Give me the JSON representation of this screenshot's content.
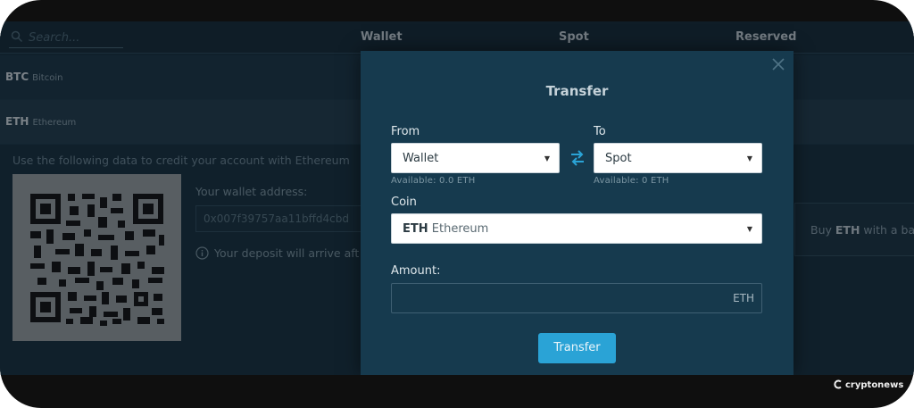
{
  "header": {
    "search_placeholder": "Search...",
    "columns": [
      "Wallet",
      "Spot",
      "Reserved"
    ]
  },
  "assets": [
    {
      "symbol": "BTC",
      "name": "Bitcoin"
    },
    {
      "symbol": "ETH",
      "name": "Ethereum"
    }
  ],
  "deposit": {
    "instruction": "Use the following data to credit your account with Ethereum",
    "wallet_label": "Your wallet address:",
    "wallet_address": "0x007f39757aa11bffd4cbd",
    "notice": "Your deposit will arrive aft",
    "buy_prefix": "Buy",
    "buy_asset": "ETH",
    "buy_suffix": "with a ba"
  },
  "modal": {
    "title": "Transfer",
    "from_label": "From",
    "from_value": "Wallet",
    "from_available": "Available: 0.0 ETH",
    "to_label": "To",
    "to_value": "Spot",
    "to_available": "Available: 0 ETH",
    "coin_label": "Coin",
    "coin_symbol": "ETH",
    "coin_name": "Ethereum",
    "amount_label": "Amount:",
    "amount_value": "",
    "amount_unit": "ETH",
    "submit_label": "Transfer"
  },
  "watermark": "cryptonews",
  "icons": {
    "search": "search-icon",
    "close": "close-icon",
    "swap": "swap-arrows-icon",
    "info": "info-icon",
    "caret": "chevron-down-icon",
    "brand": "cryptonews-logo-icon"
  },
  "colors": {
    "app_bg": "#16303f",
    "modal_bg": "#163a4e",
    "accent": "#2aa3d6",
    "frame": "#0f0f0f"
  }
}
